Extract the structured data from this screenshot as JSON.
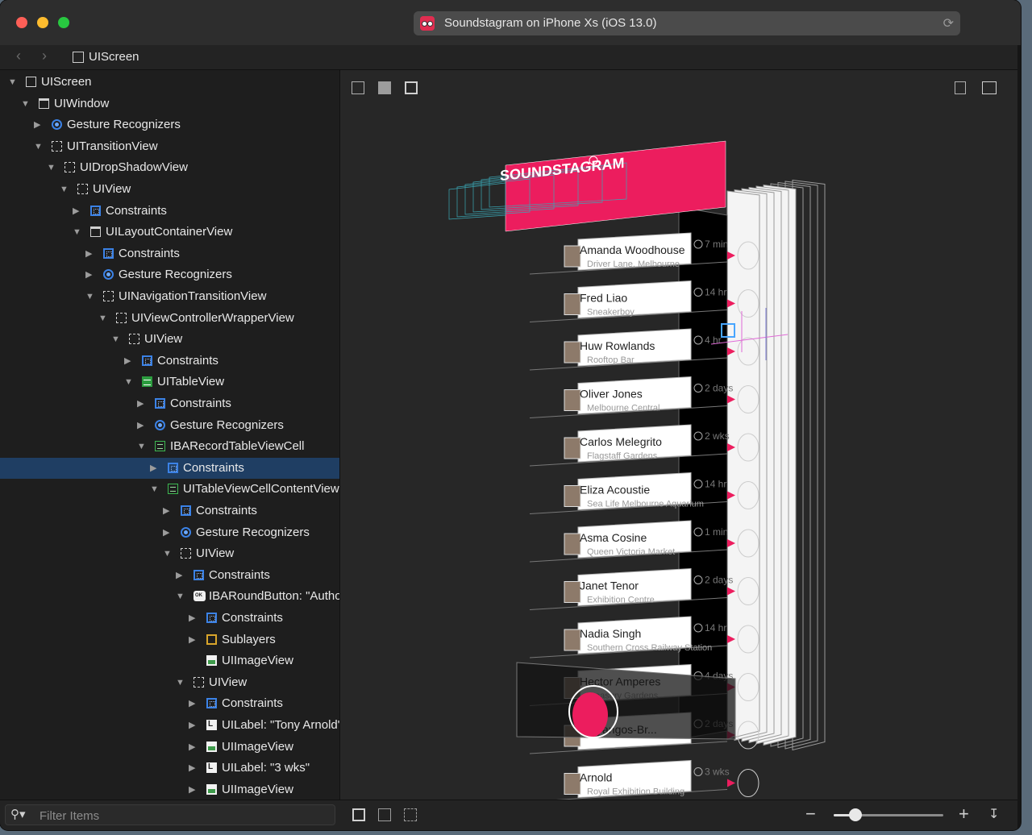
{
  "window": {
    "title": "Soundstagram on iPhone Xs (iOS 13.0)",
    "path_item": "UIScreen"
  },
  "hierarchy": [
    {
      "label": "UIScreen",
      "depth": 0,
      "icon": "screen",
      "expanded": true
    },
    {
      "label": "UIWindow",
      "depth": 1,
      "icon": "window",
      "expanded": true
    },
    {
      "label": "Gesture Recognizers",
      "depth": 2,
      "icon": "gesture",
      "expanded": false
    },
    {
      "label": "UITransitionView",
      "depth": 2,
      "icon": "view",
      "expanded": true
    },
    {
      "label": "UIDropShadowView",
      "depth": 3,
      "icon": "view",
      "expanded": true
    },
    {
      "label": "UIView",
      "depth": 4,
      "icon": "view",
      "expanded": true
    },
    {
      "label": "Constraints",
      "depth": 5,
      "icon": "constraints",
      "expanded": false
    },
    {
      "label": "UILayoutContainerView",
      "depth": 5,
      "icon": "layout",
      "expanded": true
    },
    {
      "label": "Constraints",
      "depth": 6,
      "icon": "constraints",
      "expanded": false
    },
    {
      "label": "Gesture Recognizers",
      "depth": 6,
      "icon": "gesture",
      "expanded": false
    },
    {
      "label": "UINavigationTransitionView",
      "depth": 6,
      "icon": "view",
      "expanded": true
    },
    {
      "label": "UIViewControllerWrapperView",
      "depth": 7,
      "icon": "view",
      "expanded": true
    },
    {
      "label": "UIView",
      "depth": 8,
      "icon": "view",
      "expanded": true
    },
    {
      "label": "Constraints",
      "depth": 9,
      "icon": "constraints",
      "expanded": false
    },
    {
      "label": "UITableView",
      "depth": 9,
      "icon": "table",
      "expanded": true
    },
    {
      "label": "Constraints",
      "depth": 10,
      "icon": "constraints",
      "expanded": false
    },
    {
      "label": "Gesture Recognizers",
      "depth": 10,
      "icon": "gesture",
      "expanded": false
    },
    {
      "label": "IBARecordTableViewCell",
      "depth": 10,
      "icon": "cell",
      "expanded": true
    },
    {
      "label": "Constraints",
      "depth": 11,
      "icon": "constraints",
      "expanded": false,
      "selected": true
    },
    {
      "label": "UITableViewCellContentView",
      "depth": 11,
      "icon": "cell",
      "expanded": true
    },
    {
      "label": "Constraints",
      "depth": 12,
      "icon": "constraints",
      "expanded": false
    },
    {
      "label": "Gesture Recognizers",
      "depth": 12,
      "icon": "gesture",
      "expanded": false
    },
    {
      "label": "UIView",
      "depth": 12,
      "icon": "view",
      "expanded": true
    },
    {
      "label": "Constraints",
      "depth": 13,
      "icon": "constraints",
      "expanded": false
    },
    {
      "label": "IBARoundButton: \"Author\"",
      "depth": 13,
      "icon": "button",
      "expanded": true
    },
    {
      "label": "Constraints",
      "depth": 14,
      "icon": "constraints",
      "expanded": false
    },
    {
      "label": "Sublayers",
      "depth": 14,
      "icon": "sublayers",
      "expanded": false
    },
    {
      "label": "UIImageView",
      "depth": 14,
      "icon": "image",
      "leaf": true
    },
    {
      "label": "UIView",
      "depth": 13,
      "icon": "view",
      "expanded": true
    },
    {
      "label": "Constraints",
      "depth": 14,
      "icon": "constraints",
      "expanded": false
    },
    {
      "label": "UILabel: \"Tony Arnold\"",
      "depth": 14,
      "icon": "label",
      "expanded": false
    },
    {
      "label": "UIImageView",
      "depth": 14,
      "icon": "image",
      "expanded": false
    },
    {
      "label": "UILabel: \"3 wks\"",
      "depth": 14,
      "icon": "label",
      "expanded": false
    },
    {
      "label": "UIImageView",
      "depth": 14,
      "icon": "image",
      "expanded": false
    }
  ],
  "app": {
    "header_title": "SOUNDSTAGRAM",
    "accent": "#ec1d5e",
    "records": [
      {
        "name": "Amanda Woodhouse",
        "place": "Driver Lane, Melbourne",
        "time": "7 min"
      },
      {
        "name": "Fred Liao",
        "place": "Sneakerboy",
        "time": "14 hr"
      },
      {
        "name": "Huw Rowlands",
        "place": "Rooftop Bar",
        "time": "4 hr"
      },
      {
        "name": "Oliver Jones",
        "place": "Melbourne Central",
        "time": "2 days"
      },
      {
        "name": "Carlos Melegrito",
        "place": "Flagstaff Gardens",
        "time": "2 wks"
      },
      {
        "name": "Eliza Acoustie",
        "place": "Sea Life Melbourne Aquarium",
        "time": "14 hr"
      },
      {
        "name": "Asma Cosine",
        "place": "Queen Victoria Market",
        "time": "1 min"
      },
      {
        "name": "Janet Tenor",
        "place": "Exhibition Centre",
        "time": "2 days"
      },
      {
        "name": "Nadia Singh",
        "place": "Southern Cross Railway Station",
        "time": "14 hr"
      },
      {
        "name": "Hector Amperes",
        "place": "Treasury Gardens",
        "time": "4 days"
      },
      {
        "name": "Jijayangos-Br...",
        "place": "",
        "time": "2 days"
      },
      {
        "name": "Arnold",
        "place": "Royal Exhibition Building",
        "time": "3 wks"
      }
    ]
  },
  "filter": {
    "placeholder": "Filter Items"
  },
  "zoom": {
    "level": 0.2
  },
  "icons": {
    "back": "chevron-left-icon",
    "forward": "chevron-right-icon",
    "reload": "reload-icon",
    "search": "magnifying-glass-icon",
    "zoom_out": "minus-icon",
    "zoom_in": "plus-icon"
  }
}
